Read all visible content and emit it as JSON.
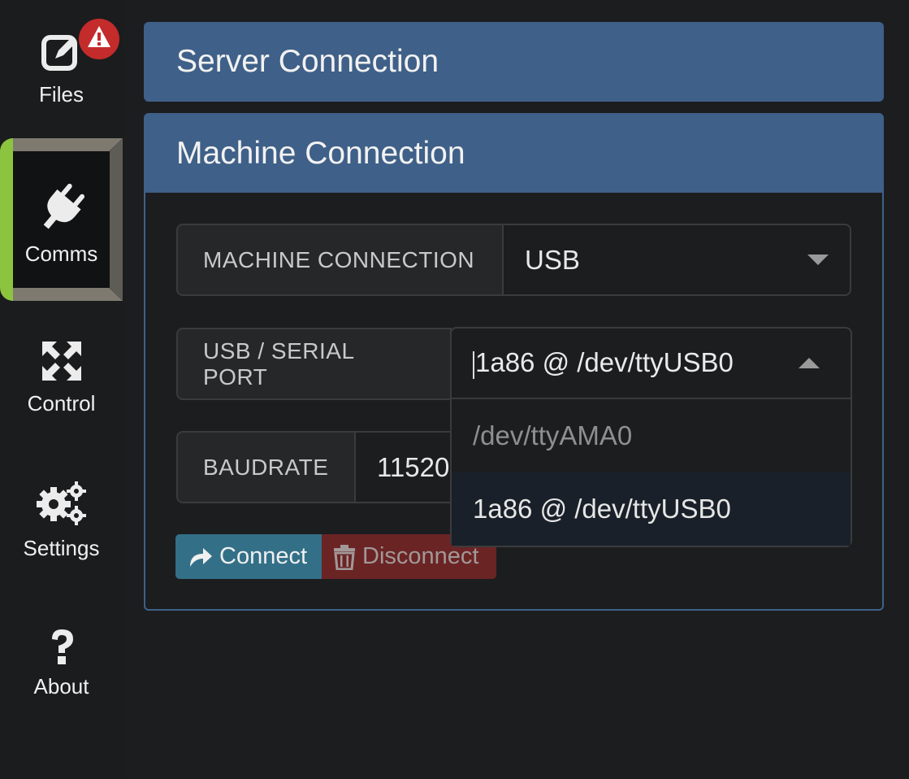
{
  "sidebar": {
    "items": [
      {
        "label": "Files",
        "icon": "file-edit-icon",
        "badge": "warning-icon"
      },
      {
        "label": "Comms",
        "icon": "plug-icon",
        "active": true
      },
      {
        "label": "Control",
        "icon": "arrows-expand-icon"
      },
      {
        "label": "Settings",
        "icon": "gears-icon"
      },
      {
        "label": "About",
        "icon": "question-icon"
      }
    ]
  },
  "server_panel": {
    "title": "Server Connection"
  },
  "machine_panel": {
    "title": "Machine Connection",
    "connection": {
      "label": "MACHINE CONNECTION",
      "value": "USB"
    },
    "port": {
      "label": "USB / SERIAL PORT",
      "value": "1a86 @ /dev/ttyUSB0",
      "options": [
        "/dev/ttyAMA0",
        "1a86 @ /dev/ttyUSB0"
      ]
    },
    "baudrate": {
      "label": "BAUDRATE",
      "value": "11520"
    },
    "connect_label": "Connect",
    "disconnect_label": "Disconnect"
  },
  "colors": {
    "accent": "#3f6088",
    "active_indicator": "#8cc43f",
    "connect": "#337088",
    "disconnect": "#6b2424",
    "badge": "#c42b2b"
  }
}
